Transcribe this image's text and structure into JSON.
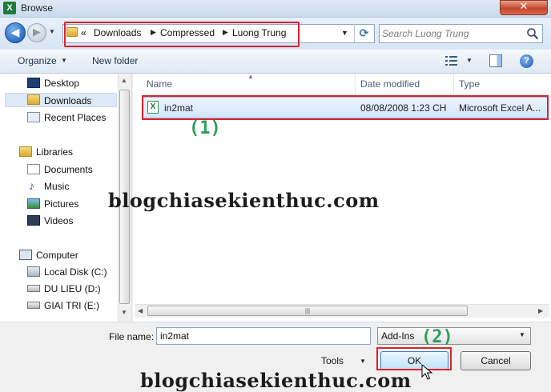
{
  "window": {
    "title": "Browse",
    "app_icon_letter": "X",
    "close_glyph": "✕"
  },
  "nav": {
    "back_glyph": "◀",
    "forward_glyph": "▶",
    "breadcrumb_prefix": "«",
    "breadcrumbs": [
      "Downloads",
      "Compressed",
      "Luong Trung"
    ],
    "search_placeholder": "Search Luong Trung"
  },
  "toolbar": {
    "organize": "Organize",
    "new_folder": "New folder",
    "help_glyph": "?"
  },
  "sidebar": {
    "favorites": [
      "Desktop",
      "Downloads",
      "Recent Places"
    ],
    "libraries_label": "Libraries",
    "libraries": [
      "Documents",
      "Music",
      "Pictures",
      "Videos"
    ],
    "computer_label": "Computer",
    "drives": [
      "Local Disk (C:)",
      "DU LIEU (D:)",
      "GIAI TRI (E:)"
    ]
  },
  "columns": {
    "name": "Name",
    "date": "Date modified",
    "type": "Type"
  },
  "files": [
    {
      "name": "in2mat",
      "date": "08/08/2008 1:23 CH",
      "type": "Microsoft Excel A..."
    }
  ],
  "annotations": {
    "step1": "(1)",
    "step2": "(2)"
  },
  "watermark": "blogchiasekienthuc.com",
  "footer": {
    "file_name_label": "File name:",
    "file_name_value": "in2mat",
    "filter_selected": "Add-Ins",
    "tools_label": "Tools",
    "ok_label": "OK",
    "cancel_label": "Cancel"
  },
  "colors": {
    "highlight_box": "#e0202d",
    "annotation": "#2e9e5b",
    "selection": "#d4e6fb"
  }
}
